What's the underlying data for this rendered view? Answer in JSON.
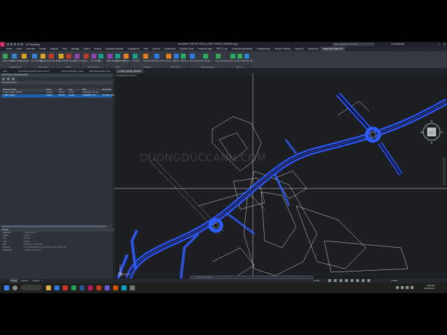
{
  "app": {
    "logo_text": "C",
    "workspace": "3D Modeling",
    "title": "Autodesk Civil 3D 2024   0_DEG_ROAD_ROSAN.dwg",
    "search_placeholder": "Type a keyword or phrase",
    "user": "DuongCanh",
    "share": "Share"
  },
  "menu_tabs": [
    "Home",
    "Insert",
    "Annotate",
    "Modify",
    "Analyze",
    "View",
    "Manage",
    "Output",
    "Survey",
    "Autodesk Inventor",
    "Transparent",
    "Help",
    "Add-ins",
    "Collaborate",
    "Express Tools",
    "Featured Apps",
    "RECT_Lay",
    "GeotechnicalModeler",
    "Subassembly",
    "Vehicle Tracking",
    "Layout-R",
    "Visual Info",
    "Visual Info Road API"
  ],
  "menu_active": "Visual Info Road API",
  "ribbon_groups": [
    {
      "label": "Management",
      "items": [
        "Create Design",
        "Setup Design",
        "Tool Space"
      ]
    },
    {
      "label": "Main chart",
      "items": [
        "Tạo mặt bằng",
        "Add tuyến",
        "Add mặt cắt"
      ]
    },
    {
      "label": "Đã Đo",
      "items": [
        "Điều chỉnh",
        "Sửa cao độ",
        "Chỉnh cống"
      ]
    },
    {
      "label": "Thành thành",
      "items": [
        "Bảng",
        "Xem chi tiết",
        "Cọc"
      ]
    },
    {
      "label": "Khác",
      "items": [
        "Bảng tổng hợp",
        "Xuất kết quả",
        "Thống kê"
      ]
    },
    {
      "label": "Thống kê",
      "items": [
        "Thống kê",
        "Thống kê trắc",
        "Thống kê khối"
      ]
    },
    {
      "label": "BV 2D/3D",
      "items": [
        "Tạo bv",
        "Mặt cắt",
        "Mặt bằng"
      ]
    },
    {
      "label": "Bản Managers",
      "items": [
        "Data Properties",
        "Profile Bg",
        "Import Templates"
      ]
    },
    {
      "label": "Tiện ích",
      "items": [
        "Kiểm tra",
        "Cập nhật",
        "Hướng dẫn"
      ]
    }
  ],
  "doc_tabs": [
    "Start",
    "HCD-BCS-00-ROAD-HP-TK-0271",
    "BDCDKLRO0AD_C002",
    "BDCDKLRO0AD_C00",
    "0_DEG_ROAD_ROSAN"
  ],
  "doc_active": "0_DEG_ROAD_ROSAN",
  "xref_panel": {
    "title": "EXTERNAL REFERENCES",
    "section": "File References",
    "columns": [
      "Reference Name",
      "Status",
      "Size",
      "Type",
      "Date",
      "Saved Path"
    ],
    "rows": [
      [
        "0_DEG_ROAD_ROSAN",
        "Opened",
        "858 KB",
        "Current",
        "12/26/2022 7:57:12...",
        ""
      ],
      [
        "0_DEG_ROAD",
        "Loaded",
        "204 KB",
        "Overlay",
        "12/26/2022 7:46:...",
        "..\\0_DEG_ROAD"
      ]
    ],
    "details_title": "Details",
    "details": [
      [
        "Reference...",
        "0_DEG_ROAD"
      ],
      [
        "Status",
        "Loaded"
      ],
      [
        "Size",
        "204 KB"
      ],
      [
        "Type",
        "Overlay"
      ],
      [
        "Date",
        "12/26/2022 7:46:33 AM"
      ],
      [
        "Found At",
        "C:\\Users\\Dell\\Documents\\ROAD\\0_DEG_ROAD.dwg"
      ],
      [
        "Saved Path",
        "..\\0_DEG_ROAD.dwg"
      ]
    ]
  },
  "viewport": {
    "label": "[-][Top][2D Wireframe]",
    "watermark": "DUONGDUCCANH.COM",
    "compass": {
      "n": "N",
      "e": "E",
      "s": "S",
      "w": "W",
      "top": "TOP"
    },
    "cmd_history": [
      "Command:",
      "Command: *Cancel*",
      "Command:"
    ],
    "cmd_placeholder": "Type a command"
  },
  "status": {
    "model": "Model",
    "layouts": [
      "Layout1",
      "Layout2"
    ],
    "add": "+",
    "scale": "1:1000",
    "zoom": "3.5000"
  },
  "taskbar": {
    "time": "4:58 AM",
    "date": "12/26/2022"
  },
  "colors": {
    "road": "#2f5cff",
    "road_fill": "#1f2f8a",
    "background": "#1c1e22",
    "linework": "#d8d8d8"
  }
}
